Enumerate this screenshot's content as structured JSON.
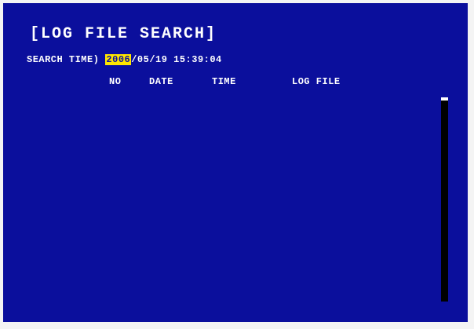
{
  "title": "[LOG FILE SEARCH]",
  "search": {
    "label": "SEARCH TIME)",
    "year": "2006",
    "rest": "/05/19 15:39:04"
  },
  "columns": {
    "no": "NO",
    "date": "DATE",
    "time": "TIME",
    "log_file": "LOG FILE"
  },
  "colors": {
    "background": "#0b0f9c",
    "highlight": "#ffe600",
    "text": "#ffffff",
    "scrollbar": "#000000"
  }
}
